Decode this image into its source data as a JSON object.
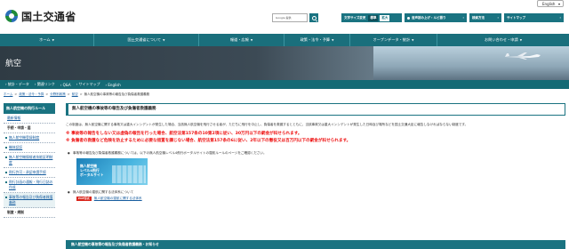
{
  "header": {
    "language": "English",
    "logo_text": "国土交通省",
    "search_placeholder": "Google 提供",
    "font_size": {
      "label": "文字サイズ変更",
      "options": [
        "標準",
        "拡大"
      ]
    },
    "buttons": {
      "speech": "音声読み上げ・ルビ振り",
      "search_tool": "検索方法",
      "sitemap": "サイトマップ"
    }
  },
  "global_nav": [
    "ホーム",
    "国土交通省について",
    "報道・広報",
    "政策・法令・予算",
    "オープンデータ・統計",
    "お問い合わせ・申請"
  ],
  "hero": {
    "title": "航空"
  },
  "sub_nav": [
    "統計・データ",
    "関連リンク",
    "Q&A",
    "サイトマップ",
    "English"
  ],
  "breadcrumb": {
    "links": [
      "ホーム",
      "政策・法令・予算",
      "分野別政策",
      "航空"
    ],
    "current": "無人航空機の事故等の報告及び負傷者救護義務"
  },
  "sidebar": {
    "heading": "無人航空機の飛行ルール",
    "items": [
      {
        "label": "最新情報",
        "kind": "link"
      },
      {
        "label": "手続・申請・届",
        "kind": "group"
      },
      {
        "label": "無人航空機登録制度",
        "kind": "sub"
      },
      {
        "label": "機体認証",
        "kind": "sub"
      },
      {
        "label": "無人航空機操縦者技能証明制度",
        "kind": "sub"
      },
      {
        "label": "飛行許可・承認申請手続",
        "kind": "sub"
      },
      {
        "label": "飛行計画の通報・飛行日誌の作成",
        "kind": "sub"
      },
      {
        "label": "事故等の報告及び負傷者救護義務",
        "kind": "sub"
      },
      {
        "label": "制度・規制",
        "kind": "group"
      }
    ]
  },
  "main": {
    "title": "無人航空機の事故等の報告及び負傷者救護義務",
    "intro": "この制度は、無人航空機に関する事故又は重大インシデントが発生した場合、当該無人航空機を飛行させる者が、ただちに飛行を中止し、負傷者を救護するとともに、当該事故又は重大インシデントが発生した日時及び場所などを国土交通大臣に報告しなければならない制度です。",
    "warnings": [
      "※ 事故等の報告をしない又は虚偽の報告を行った場合、航空法第157条の10第2項に従い、30万円以下の罰金が科せられます。",
      "※ 負傷者の救護など危険を防止するために必要な措置を講じない場合、航空法第157条の6に従い、2年以下の懲役又は百万円以下の罰金が科せられます。"
    ],
    "bullet1": "事故等の報告及び負傷者救護義務については、以下の無人航空機レベル4飛行ポータルサイトの運航ルールのページをご確認ください。",
    "portal_banner": "無人航空機\nレベル4飛行\nポータルサイト",
    "bullet2": "無人航空機の運航に関する法体系について",
    "pdf_badge": "PDF形式",
    "pdf_link": "無人航空機の運航に関する法体系",
    "section_bar": "無人航空機の事故等の報告及び負傷者救護義務・お知らせ"
  }
}
